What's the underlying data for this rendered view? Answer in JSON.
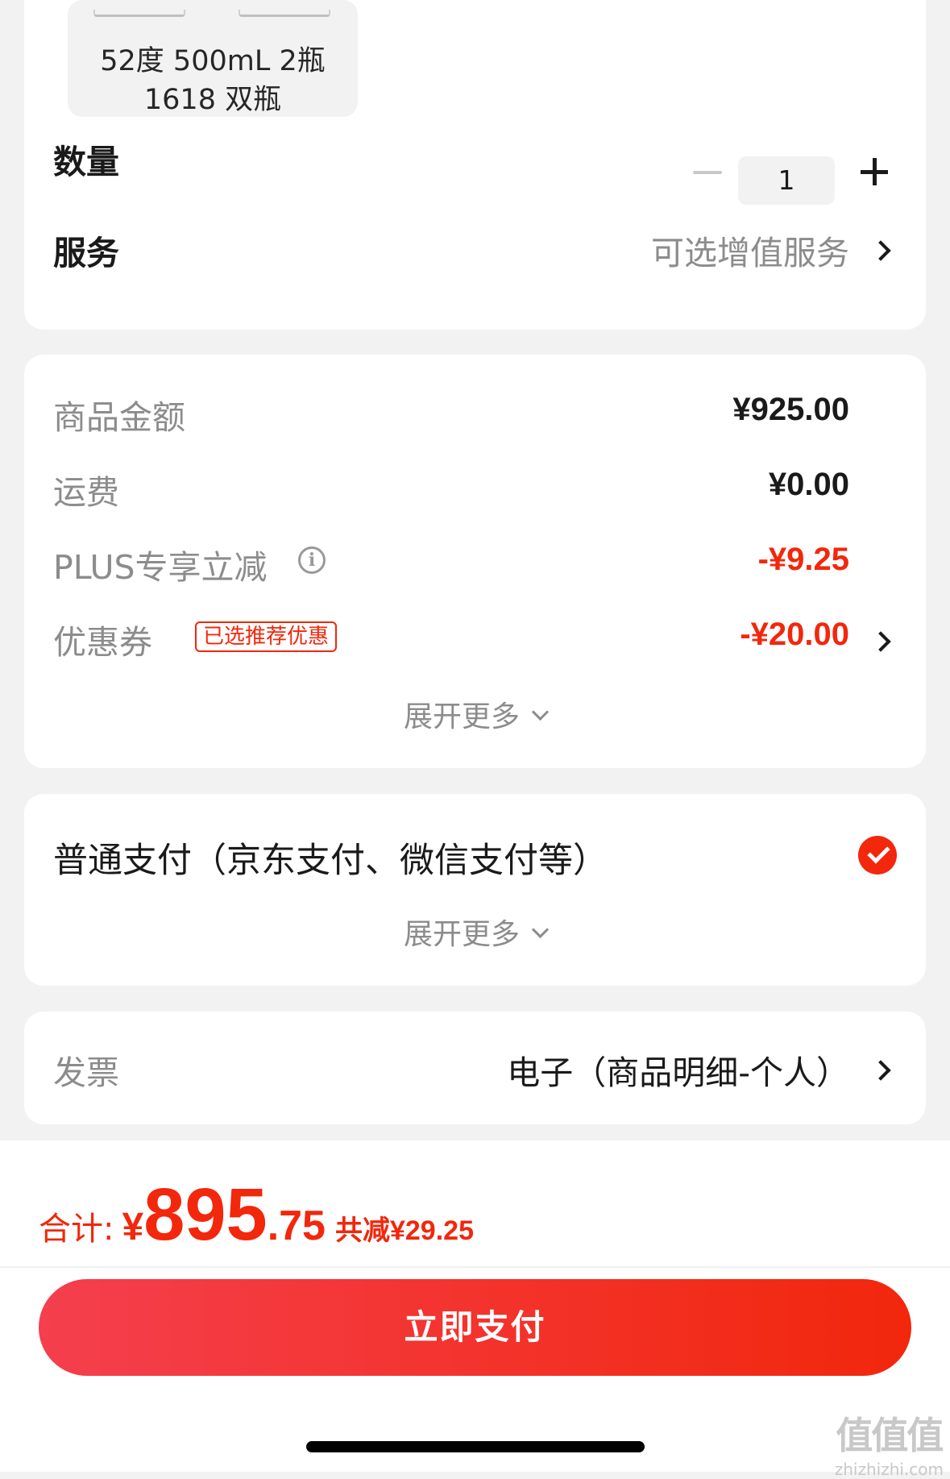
{
  "product": {
    "spec_line1": "52度 500mL 2瓶",
    "spec_line2": "1618 双瓶"
  },
  "quantity": {
    "label": "数量",
    "value": "1"
  },
  "service": {
    "label": "服务",
    "value": "可选增值服务"
  },
  "price": {
    "goods_label": "商品金额",
    "goods_value": "¥925.00",
    "shipping_label": "运费",
    "shipping_value": "¥0.00",
    "plus_label": "PLUS专享立减",
    "plus_value": "-¥9.25",
    "coupon_label": "优惠券",
    "coupon_tag": "已选推荐优惠",
    "coupon_value": "-¥20.00",
    "expand_label": "展开更多"
  },
  "payment": {
    "method": "普通支付（京东支付、微信支付等）",
    "selected": true,
    "expand_label": "展开更多"
  },
  "invoice": {
    "label": "发票",
    "value": "电子（商品明细-个人）"
  },
  "footer": {
    "total_label": "合计:",
    "currency": "¥",
    "total_integer": "895",
    "total_decimal": ".75",
    "saved_text": "共减¥29.25",
    "pay_button": "立即支付"
  },
  "watermark": {
    "main": "值值值",
    "sub": "zhizhizhi.com"
  },
  "colors": {
    "accent": "#f2270c",
    "muted_text": "#8c8c8c",
    "background": "#f2f2f2"
  }
}
